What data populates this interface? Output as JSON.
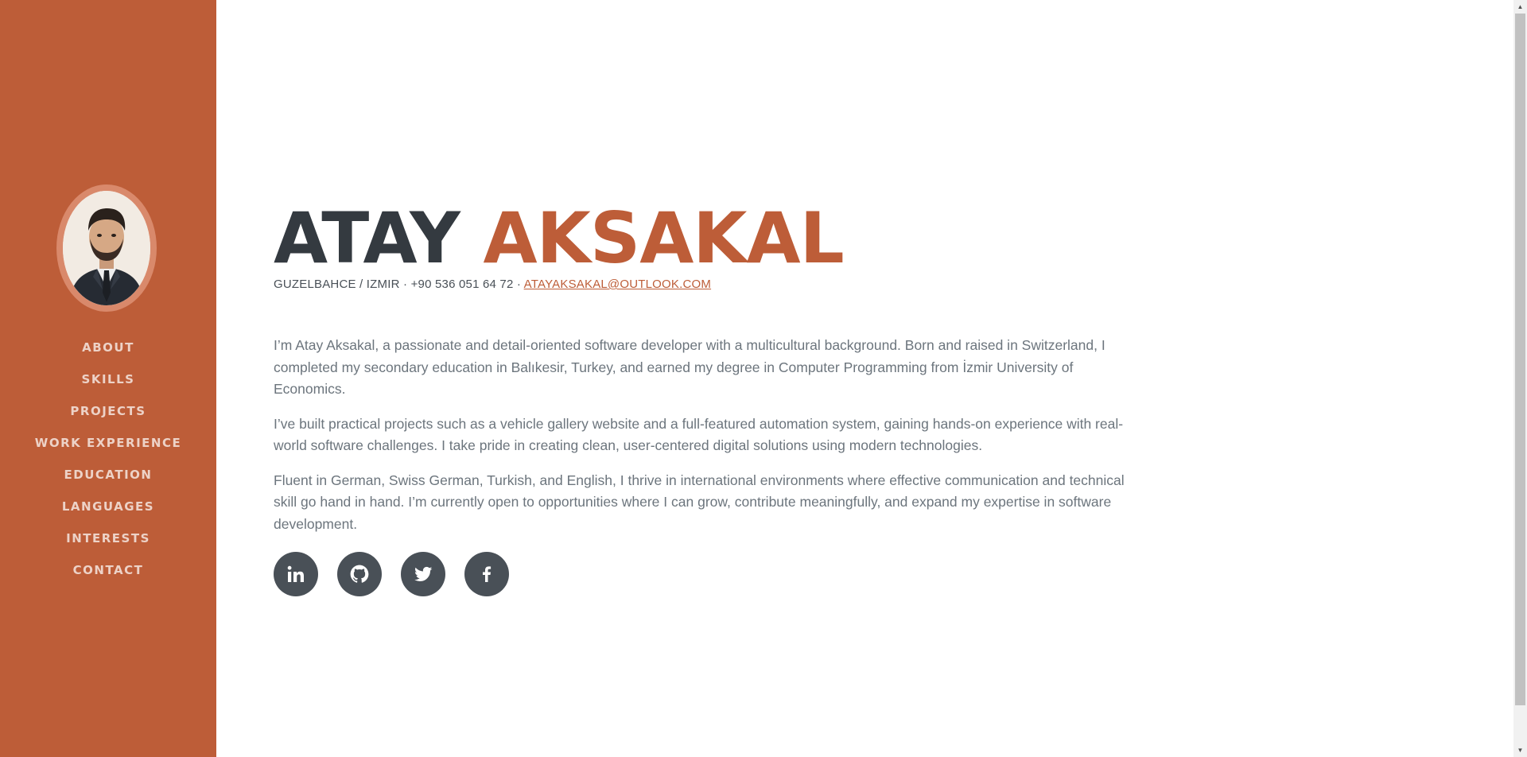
{
  "profile": {
    "first_name": "ATAY",
    "last_name": "AKSAKAL",
    "location": "GUZELBAHCE / IZMIR",
    "separator": "·",
    "phone": "+90 536 051 64 72",
    "email": "ATAYAKSAKAL@OUTLOOK.COM",
    "avatar_icon": "profile-photo"
  },
  "nav": {
    "items": [
      {
        "label": "ABOUT"
      },
      {
        "label": "SKILLS"
      },
      {
        "label": "PROJECTS"
      },
      {
        "label": "WORK EXPERIENCE"
      },
      {
        "label": "EDUCATION"
      },
      {
        "label": "LANGUAGES"
      },
      {
        "label": "INTERESTS"
      },
      {
        "label": "CONTACT"
      }
    ]
  },
  "about": {
    "paragraphs": [
      "I’m Atay Aksakal, a passionate and detail-oriented software developer with a multicultural background. Born and raised in Switzerland, I completed my secondary education in Balıkesir, Turkey, and earned my degree in Computer Programming from İzmir University of Economics.",
      "I’ve built practical projects such as a vehicle gallery website and a full-featured automation system, gaining hands-on experience with real-world software challenges. I take pride in creating clean, user-centered digital solutions using modern technologies.",
      "Fluent in German, Swiss German, Turkish, and English, I thrive in international environments where effective communication and technical skill go hand in hand. I’m currently open to opportunities where I can grow, contribute meaningfully, and expand my expertise in software development."
    ]
  },
  "socials": [
    {
      "icon": "linkedin-icon"
    },
    {
      "icon": "github-icon"
    },
    {
      "icon": "twitter-icon"
    },
    {
      "icon": "facebook-icon"
    }
  ],
  "colors": {
    "accent": "#bd5d38",
    "dark": "#343a40",
    "text": "#6c757d",
    "social_bg": "#495057"
  }
}
